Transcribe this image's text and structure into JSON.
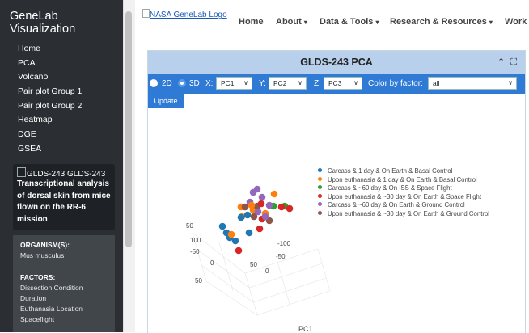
{
  "sidebar": {
    "title": "GeneLab Visualization",
    "nav": [
      "Home",
      "PCA",
      "Volcano",
      "Pair plot Group 1",
      "Pair plot Group 2",
      "Heatmap",
      "DGE",
      "GSEA"
    ],
    "dataset_id": "GLDS-243 GLDS-243",
    "dataset_description": "Transcriptional analysis of dorsal skin from mice flown on the RR-6 mission",
    "organism_label": "ORGANISM(S):",
    "organism": "Mus musculus",
    "factors_label": "FACTORS:",
    "factors": [
      "Dissection Condition",
      "Duration",
      "Euthanasia Location",
      "Spaceflight"
    ]
  },
  "header": {
    "logo_alt": "NASA GeneLab Logo",
    "nav": [
      {
        "label": "Home",
        "caret": false
      },
      {
        "label": "About",
        "caret": true
      },
      {
        "label": "Data & Tools",
        "caret": true
      },
      {
        "label": "Research & Resources",
        "caret": true
      },
      {
        "label": "Work",
        "caret": false
      }
    ]
  },
  "panel": {
    "title": "GLDS-243 PCA",
    "controls": {
      "mode_2d": "2D",
      "mode_3d": "3D",
      "selected_mode": "3D",
      "x_label": "X:",
      "x_value": "PC1",
      "y_label": "Y:",
      "y_value": "PC2",
      "z_label": "Z:",
      "z_value": "PC3",
      "color_label": "Color by factor:",
      "color_value": "all"
    },
    "update_label": "Update"
  },
  "colors": {
    "sidebar_bg": "#2b2f33",
    "accent": "#2f7ad5",
    "panel_header": "#b9d0ec"
  },
  "chart_data": {
    "type": "scatter",
    "projection": "3d",
    "axis_labels": {
      "x": "PC1"
    },
    "tick_labels": [
      "50",
      "100",
      "-50",
      "0",
      "50",
      "-100",
      "-50",
      "0",
      "50"
    ],
    "legend": [
      {
        "name": "Carcass & 1 day & On Earth & Basal Control",
        "color": "#1f77b4"
      },
      {
        "name": "Upon euthanasia & 1 day & On Earth & Basal Control",
        "color": "#ff7f0e"
      },
      {
        "name": "Carcass & ~60 day & On ISS & Space Flight",
        "color": "#2ca02c"
      },
      {
        "name": "Upon euthanasia & ~30 day & On Earth & Space Flight",
        "color": "#d62728"
      },
      {
        "name": "Carcass & ~60 day & On Earth & Ground Control",
        "color": "#9467bd"
      },
      {
        "name": "Upon euthanasia & ~30 day & On Earth & Ground Control",
        "color": "#8c564b"
      }
    ]
  }
}
